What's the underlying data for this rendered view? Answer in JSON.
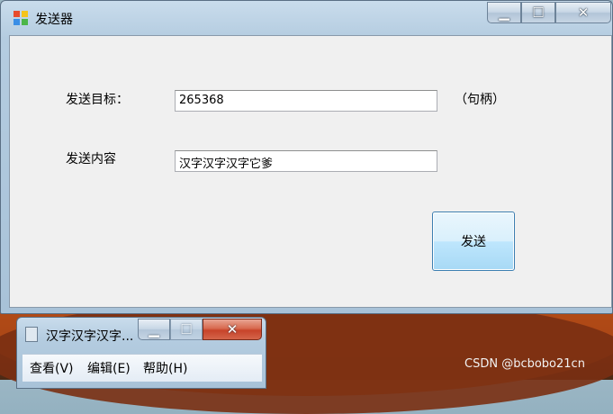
{
  "window": {
    "title": "发送器",
    "controls": {
      "minimize": "▁",
      "maximize": "☐",
      "close": "✕"
    }
  },
  "form": {
    "target_label": "发送目标：",
    "target_value": "265368",
    "target_hint": "（句柄）",
    "content_label": "发送内容",
    "content_value": "汉字汉字汉字它爹",
    "send_button": "发送"
  },
  "background_window": {
    "title": "汉字汉字汉字...",
    "controls": {
      "minimize": "▁",
      "maximize": "☐",
      "close": "✕"
    },
    "menu": [
      "查看(V)",
      "编辑(E)",
      "帮助(H)"
    ]
  },
  "watermark": "CSDN @bcbobo21cn"
}
